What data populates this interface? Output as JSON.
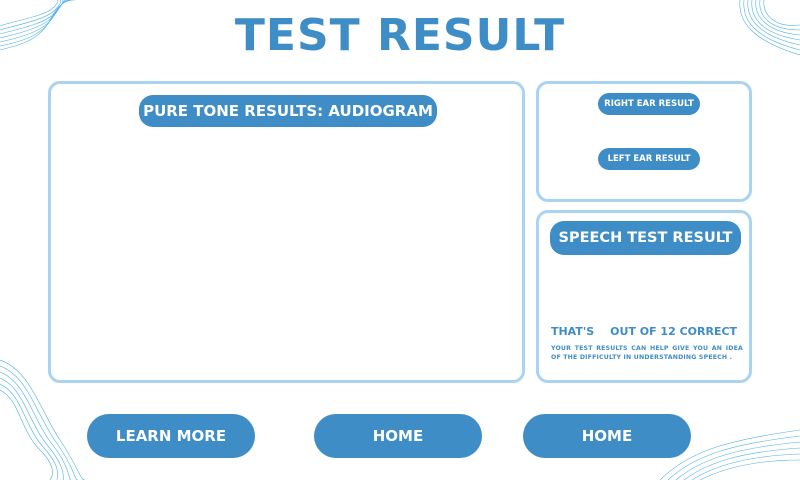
{
  "page": {
    "title": "TEST RESULT"
  },
  "audiogram": {
    "title": "PURE TONE RESULTS: AUDIOGRAM"
  },
  "ear_results": {
    "right_label": "RIGHT EAR RESULT",
    "left_label": "LEFT EAR RESULT"
  },
  "speech": {
    "title": "SPEECH TEST RESULT",
    "score_prefix": "THAT'S",
    "score_suffix": "OUT OF 12 CORRECT",
    "description": "YOUR TEST RESULTS CAN HELP GIVE YOU AN IDEA OF THE DIFFICULTY IN UNDERSTANDING SPEECH ."
  },
  "buttons": {
    "learn_more": "LEARN MORE",
    "home_1": "HOME",
    "home_2": "HOME"
  },
  "colors": {
    "accent": "#3f8dc6",
    "border": "#a9d3f3"
  }
}
